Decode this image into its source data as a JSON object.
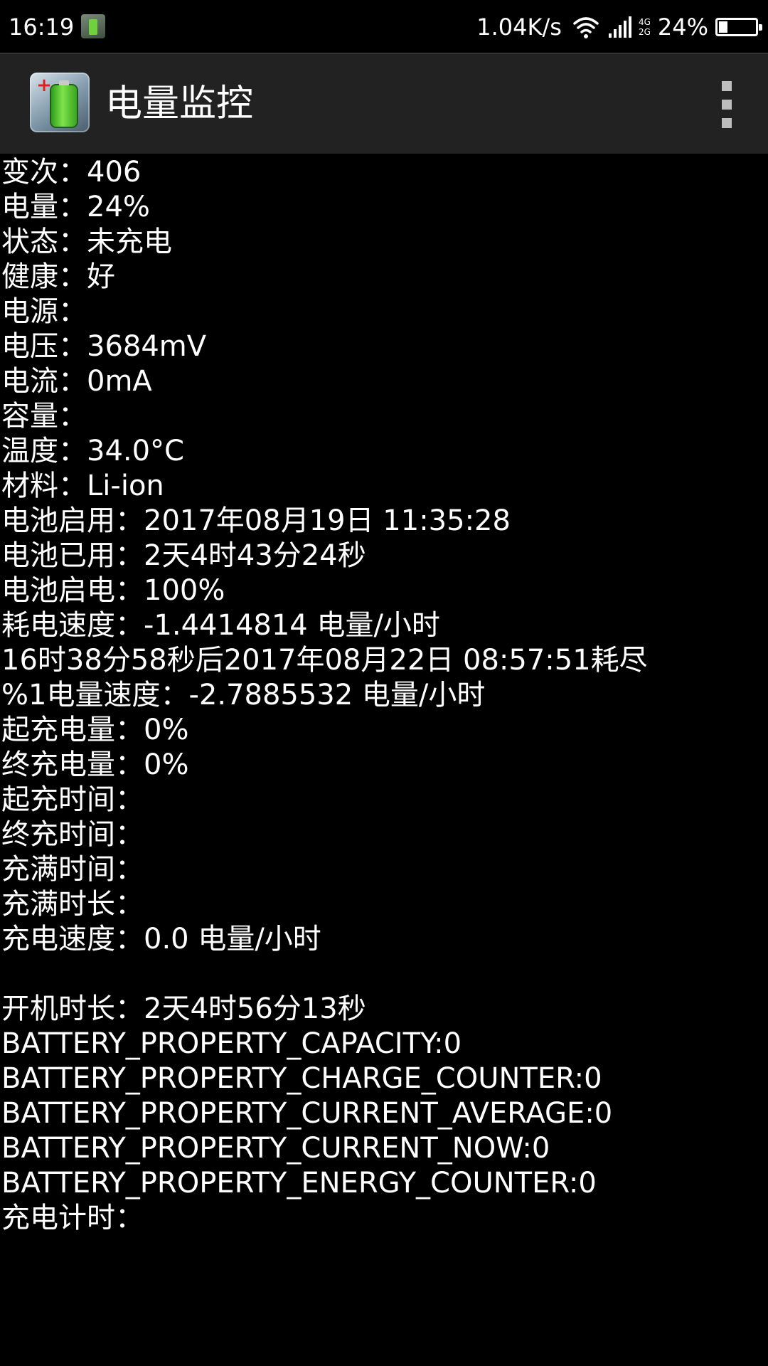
{
  "status_bar": {
    "time": "16:19",
    "net_speed": "1.04K/s",
    "net_type_top": "4G",
    "net_type_bottom": "2G",
    "battery_pct": "24%",
    "battery_level": 0.24,
    "icons": [
      "app-notification-icon",
      "wifi-icon",
      "signal-icon",
      "battery-icon"
    ]
  },
  "app_bar": {
    "title": "电量监控",
    "logo_icon": "battery-logo-icon",
    "menu_icon": "overflow-menu-icon"
  },
  "lines": [
    "变次：406",
    "电量：24%",
    "状态：未充电",
    "健康：好",
    "电源：",
    "电压：3684mV",
    "电流：0mA",
    "容量：",
    "温度：34.0°C",
    "材料：Li-ion",
    "电池启用：2017年08月19日 11:35:28",
    "电池已用：2天4时43分24秒",
    "电池启电：100%",
    "耗电速度：-1.4414814 电量/小时",
    "16时38分58秒后2017年08月22日 08:57:51耗尽",
    "%1电量速度：-2.7885532 电量/小时",
    "起充电量：0%",
    "终充电量：0%",
    "起充时间：",
    "终充时间：",
    "充满时间：",
    "充满时长：",
    "充电速度：0.0 电量/小时",
    "",
    "开机时长：2天4时56分13秒",
    "BATTERY_PROPERTY_CAPACITY:0",
    "BATTERY_PROPERTY_CHARGE_COUNTER:0",
    "BATTERY_PROPERTY_CURRENT_AVERAGE:0",
    "BATTERY_PROPERTY_CURRENT_NOW:0",
    "BATTERY_PROPERTY_ENERGY_COUNTER:0",
    "充电计时："
  ]
}
